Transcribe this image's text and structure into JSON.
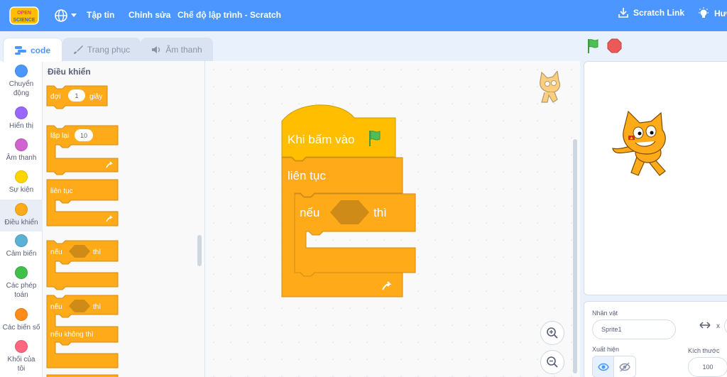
{
  "menubar": {
    "logo_line1": "OPEN",
    "logo_line2": "SCIENCE",
    "file": "Tập tin",
    "edit": "Chỉnh sửa",
    "mode": "Chế độ lập trình - Scratch",
    "scratch_link": "Scratch Link",
    "tutorials": "Hướ"
  },
  "tabs": [
    {
      "label": "code",
      "icon": "code-icon"
    },
    {
      "label": "Trang phục",
      "icon": "paintbrush-icon"
    },
    {
      "label": "Âm thanh",
      "icon": "speaker-icon"
    }
  ],
  "categories": [
    {
      "label": "Chuyển động",
      "color": "#4c97ff"
    },
    {
      "label": "Hiển thị",
      "color": "#9966ff"
    },
    {
      "label": "Âm thanh",
      "color": "#cf63cf"
    },
    {
      "label": "Sự kiện",
      "color": "#ffd500"
    },
    {
      "label": "Điều khiển",
      "color": "#ffab19"
    },
    {
      "label": "Cảm biến",
      "color": "#5cb1d6"
    },
    {
      "label": "Các phép toán",
      "color": "#40bf4a"
    },
    {
      "label": "Các biến số",
      "color": "#ff8c1a"
    },
    {
      "label": "Khối của tôi",
      "color": "#ff6680"
    }
  ],
  "palette": {
    "title": "Điều khiển",
    "wait_label": "đợi",
    "wait_value": "1",
    "wait_unit": "giây",
    "repeat_label": "lặp lại",
    "repeat_value": "10",
    "forever_label": "liên tục",
    "if_label": "nếu",
    "then_label": "thì",
    "if2_label": "nếu",
    "then2_label": "thì",
    "else_label": "nếu không thì"
  },
  "script": {
    "hat_label": "Khi bấm vào",
    "forever_label": "liên tục",
    "if_label": "nếu",
    "then_label": "thì"
  },
  "sprite_info": {
    "sprite_label": "Nhân vật",
    "sprite_name": "Sprite1",
    "x_label": "x",
    "show_label": "Xuất hiện",
    "size_label": "Kích thước",
    "size_value": "100"
  },
  "colors": {
    "control": "#ffab19",
    "control_dark": "#cf8b17",
    "menubar": "#4c97ff",
    "flag": "#4cbf56",
    "stop": "#ec5959"
  }
}
